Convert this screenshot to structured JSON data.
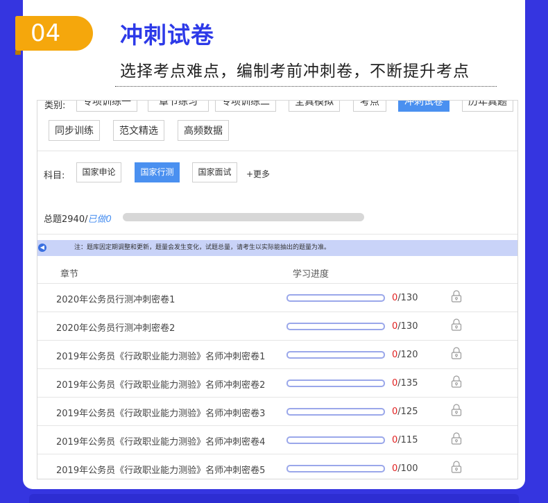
{
  "header": {
    "badge_number": "04",
    "title": "冲刺试卷",
    "subtitle": "选择考点难点，编制考前冲刺卷，不断提升考点"
  },
  "category": {
    "label": "类别:",
    "items": [
      {
        "label": "专项训练一",
        "active": false
      },
      {
        "label": "章节练习",
        "active": false
      },
      {
        "label": "专项训练二",
        "active": false
      },
      {
        "label": "全真模拟",
        "active": false
      },
      {
        "label": "考点",
        "active": false
      },
      {
        "label": "冲刺试卷",
        "active": true
      },
      {
        "label": "历年真题",
        "active": false
      },
      {
        "label": "同步训练",
        "active": false
      },
      {
        "label": "范文精选",
        "active": false
      },
      {
        "label": "高频数据",
        "active": false
      }
    ]
  },
  "subject": {
    "label": "科目:",
    "items": [
      {
        "label": "国家申论",
        "active": false
      },
      {
        "label": "国家行测",
        "active": true
      },
      {
        "label": "国家面试",
        "active": false
      }
    ],
    "more": "+更多"
  },
  "summary": {
    "total_label": "总题2940/",
    "done_label": "已做0"
  },
  "notice": "注：题库因定期调整和更新，题量会发生变化，试题总量，请考生以实际能抽出的题量为准。",
  "table": {
    "headers": [
      "章节",
      "学习进度"
    ],
    "rows": [
      {
        "name": "2020年公务员行测冲刺密卷1",
        "done": "0",
        "total": "/130",
        "progress": 0
      },
      {
        "name": "2020年公务员行测冲刺密卷2",
        "done": "0",
        "total": "/130",
        "progress": 0
      },
      {
        "name": "2019年公务员《行政职业能力测验》名师冲刺密卷1",
        "done": "0",
        "total": "/120",
        "progress": 0
      },
      {
        "name": "2019年公务员《行政职业能力测验》名师冲刺密卷2",
        "done": "0",
        "total": "/135",
        "progress": 0
      },
      {
        "name": "2019年公务员《行政职业能力测验》名师冲刺密卷3",
        "done": "0",
        "total": "/125",
        "progress": 0
      },
      {
        "name": "2019年公务员《行政职业能力测验》名师冲刺密卷4",
        "done": "0",
        "total": "/115",
        "progress": 0
      },
      {
        "name": "2019年公务员《行政职业能力测验》名师冲刺密卷5",
        "done": "0",
        "total": "/100",
        "progress": 0
      }
    ]
  },
  "colors": {
    "background": "#3535e0",
    "badge": "#f5a70c",
    "title": "#2d3ae8",
    "accent": "#4a90f0",
    "zero_count": "#e02020"
  }
}
